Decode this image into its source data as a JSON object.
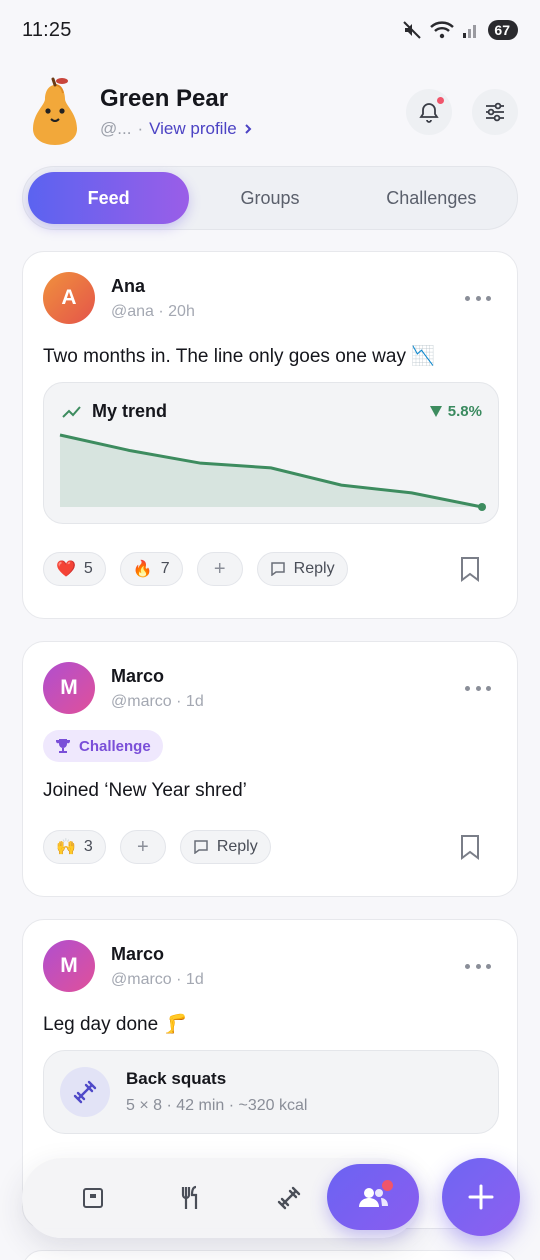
{
  "status_bar": {
    "time": "11:25",
    "battery": "67"
  },
  "header": {
    "name": "Green Pear",
    "handle": "@...",
    "view_profile": "View profile"
  },
  "tabs": [
    {
      "label": "Feed",
      "active": true
    },
    {
      "label": "Groups",
      "active": false
    },
    {
      "label": "Challenges",
      "active": false
    }
  ],
  "posts": [
    {
      "initial": "A",
      "name": "Ana",
      "meta": "@ana · 20h",
      "text": "Two months in. The line only goes one way 📉",
      "trend": {
        "title": "My trend",
        "change": "5.8%",
        "direction": "down",
        "chart_data": {
          "type": "area",
          "values": [
            100,
            95,
            91,
            89.5,
            84,
            81.5,
            77
          ],
          "color": "#3d8c5f"
        }
      },
      "reactions": [
        {
          "emoji": "❤️",
          "count": "5"
        },
        {
          "emoji": "🔥",
          "count": "7"
        }
      ],
      "reply": "Reply"
    },
    {
      "initial": "M",
      "name": "Marco",
      "meta": "@marco · 1d",
      "badge": "Challenge",
      "text": "Joined ‘New Year shred’",
      "reactions": [
        {
          "emoji": "🙌",
          "count": "3"
        }
      ],
      "reply": "Reply"
    },
    {
      "initial": "M",
      "name": "Marco",
      "meta": "@marco · 1d",
      "text": "Leg day done 🦵",
      "workout": {
        "title": "Back squats",
        "detail": "5 × 8 · 42 min · ~320 kcal"
      }
    }
  ],
  "colors": {
    "accent": "#6b63f2",
    "trend_green": "#3d8c5f",
    "notification": "#f0556b"
  },
  "bottom_nav": [
    "diary-icon",
    "food-icon",
    "workout-icon",
    "community-icon"
  ]
}
